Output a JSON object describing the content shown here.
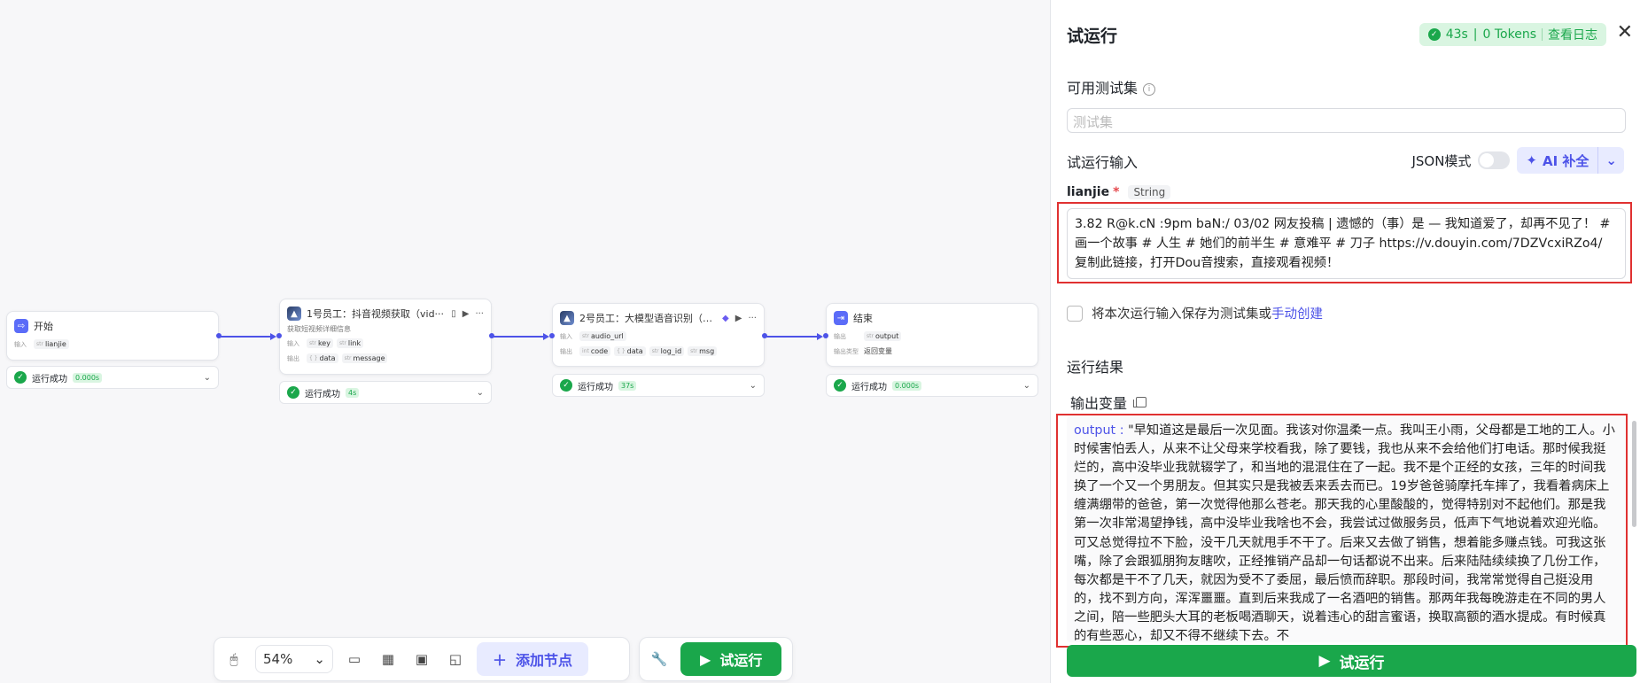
{
  "nodes": {
    "start": {
      "title": "开始",
      "input_label": "输入",
      "type": "str",
      "var": "lianjie"
    },
    "n1": {
      "title": "1号员工：抖音视频获取（vid···",
      "desc": "获取短视频详细信息",
      "input_label": "输入",
      "output_label": "输出",
      "type": "str",
      "in1": "key",
      "in2": "link",
      "obj_type": "{ }",
      "out1": "data",
      "out2": "message"
    },
    "n2": {
      "title": "2号员工：大模型语音识别（a···",
      "input_label": "输入",
      "output_label": "输出",
      "type": "str",
      "int_type": "int",
      "obj_type": "{ }",
      "in1": "audio_url",
      "out1": "code",
      "out2": "data",
      "out3": "log_id",
      "out4": "msg"
    },
    "end": {
      "title": "结束",
      "output_label": "输出",
      "type": "str",
      "var": "output",
      "output_type_label": "输出类型",
      "output_type_value": "返回变量"
    }
  },
  "statuses": {
    "label": "运行成功",
    "start_time": "0.000s",
    "n1_time": "4s",
    "n2_time": "37s",
    "end_time": "0.000s"
  },
  "toolbar": {
    "zoom": "54%",
    "add_node": "添加节点",
    "run": "试运行"
  },
  "panel": {
    "title": "试运行",
    "log": {
      "duration": "43s",
      "tokens": "0 Tokens",
      "view_log": "查看日志"
    },
    "testset_label": "可用测试集",
    "testset_placeholder": "测试集",
    "input_section": "试运行输入",
    "json_mode": "JSON模式",
    "ai_fill": "AI 补全",
    "field_name": "lianjie",
    "field_type": "String",
    "field_value": "3.82 R@k.cN :9pm baN:/ 03/02 网友投稿 | 遗憾的（事）是 — 我知道爱了，却再不见了！ # 画一个故事 # 人生 # 她们的前半生 # 意难平 # 刀子  https://v.douyin.com/7DZVcxiRZo4/ 复制此链接，打开Dou音搜索，直接观看视频！",
    "save_text": "将本次运行输入保存为测试集或",
    "manual_create": "手动创建",
    "result_section": "运行结果",
    "output_vars": "输出变量",
    "output_key": "output",
    "output_value": "\"早知道这是最后一次见面。我该对你温柔一点。我叫王小雨，父母都是工地的工人。小时候害怕丢人，从来不让父母来学校看我，除了要钱，我也从来不会给他们打电话。那时候我挺烂的，高中没毕业我就辍学了，和当地的混混住在了一起。我不是个正经的女孩，三年的时间我换了一个又一个男朋友。但其实只是我被丢来丢去而已。19岁爸爸骑摩托车摔了，我看着病床上缠满绷带的爸爸，第一次觉得他那么苍老。那天我的心里酸酸的，觉得特别对不起他们。那是我第一次非常渴望挣钱，高中没毕业我啥也不会，我尝试过做服务员，低声下气地说着欢迎光临。可又总觉得拉不下脸，没干几天就甩手不干了。后来又去做了销售，想着能多赚点钱。可我这张嘴，除了会跟狐朋狗友瞎吹，正经推销产品却一句话都说不出来。后来陆陆续续换了几份工作，每次都是干不了几天，就因为受不了委屈，最后愤而辞职。那段时间，我常常觉得自己挺没用的，找不到方向，浑浑噩噩。直到后来我成了一名酒吧的销售。那两年我每晚游走在不同的男人之间，陪一些肥头大耳的老板喝酒聊天，说着违心的甜言蜜语，换取高额的酒水提成。有时候真的有些恶心，却又不得不继续下去。不",
    "run_button": "试运行"
  }
}
